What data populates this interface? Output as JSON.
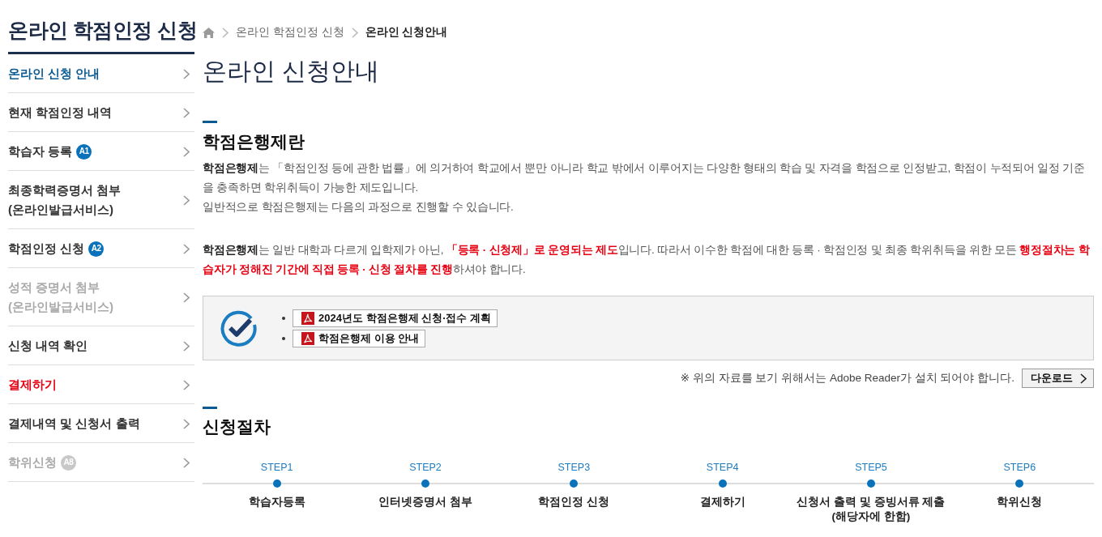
{
  "sidebar": {
    "title": "온라인 학점인정 신청",
    "items": [
      {
        "lines": [
          "온라인 신청 안내"
        ],
        "selected": true,
        "disabled": false,
        "emphasized": false
      },
      {
        "lines": [
          "현재 학점인정 내역"
        ],
        "selected": false,
        "disabled": false,
        "emphasized": false
      },
      {
        "lines": [
          "학습자 등록"
        ],
        "badge": "A1",
        "selected": false,
        "disabled": false,
        "emphasized": false
      },
      {
        "lines": [
          "최종학력증명서 첨부",
          "(온라인발급서비스)"
        ],
        "selected": false,
        "disabled": false,
        "emphasized": false
      },
      {
        "lines": [
          "학점인정 신청"
        ],
        "badge": "A2",
        "selected": false,
        "disabled": false,
        "emphasized": false
      },
      {
        "lines": [
          "성적 증명서 첨부",
          "(온라인발급서비스)"
        ],
        "selected": false,
        "disabled": true,
        "emphasized": false
      },
      {
        "lines": [
          "신청 내역 확인"
        ],
        "selected": false,
        "disabled": false,
        "emphasized": false
      },
      {
        "lines": [
          "결제하기"
        ],
        "selected": false,
        "disabled": false,
        "emphasized": true
      },
      {
        "lines": [
          "결제내역 및 신청서 출력"
        ],
        "selected": false,
        "disabled": false,
        "emphasized": false
      },
      {
        "lines": [
          "학위신청"
        ],
        "badge": "A8",
        "selected": false,
        "disabled": true,
        "emphasized": false
      }
    ]
  },
  "breadcrumb": [
    {
      "label": "온라인 학점인정 신청",
      "current": false
    },
    {
      "label": "온라인 신청안내",
      "current": true
    }
  ],
  "page_title": "온라인 신청안내",
  "about": {
    "heading": "학점은행제란",
    "description": [
      [
        {
          "kind": "strong",
          "text": "학점은행제"
        },
        {
          "kind": "plain",
          "text": "는 「학점인정 등에 관한 법률」에 의거하여 학교에서 뿐만 아니라 학교 밖에서 이루어지는 다양한 형태의 학습 및 자격을 학점으로 인정받고, 학점이 누적되어 일정 기준을 충족하면 학위취득이 가능한 제도입니다."
        }
      ],
      [
        {
          "kind": "plain",
          "text": "일반적으로 학점은행제는 다음의 과정으로 진행할 수 있습니다."
        }
      ]
    ],
    "notice": [
      {
        "kind": "strong",
        "text": "학점은행제"
      },
      {
        "kind": "plain",
        "text": "는 일반 대학과 다르게 입학제가 아닌, "
      },
      {
        "kind": "alert",
        "text": "「등록 · 신청제」로 운영되는 제도"
      },
      {
        "kind": "plain",
        "text": "입니다. 따라서 이수한 학점에 대한 등록 · 학점인정 및 최종 학위취득을 위한 모든 "
      },
      {
        "kind": "alert",
        "text": "행정절차는 학습자가 정해진 기간에 직접 등록 · 신청 절차를 진행"
      },
      {
        "kind": "plain",
        "text": "하셔야 합니다."
      }
    ],
    "downloads": [
      {
        "label": "2024년도 학점은행제 신청·접수 계획"
      },
      {
        "label": "학점은행제 이용 안내"
      }
    ],
    "reader_note": "※ 위의 자료를 보기 위해서는 Adobe Reader가 설치 되어야 합니다.",
    "reader_button": "다운로드"
  },
  "procedure": {
    "heading": "신청절차",
    "steps": [
      {
        "step": "STEP1",
        "lines": [
          "학습자등록"
        ]
      },
      {
        "step": "STEP2",
        "lines": [
          "인터넷증명서 첨부"
        ]
      },
      {
        "step": "STEP3",
        "lines": [
          "학점인정 신청"
        ]
      },
      {
        "step": "STEP4",
        "lines": [
          "결제하기"
        ]
      },
      {
        "step": "STEP5",
        "lines": [
          "신청서 출력 및 증빙서류 제출",
          "(해당자에 한함)"
        ]
      },
      {
        "step": "STEP6",
        "lines": [
          "학위신청"
        ]
      }
    ]
  }
}
